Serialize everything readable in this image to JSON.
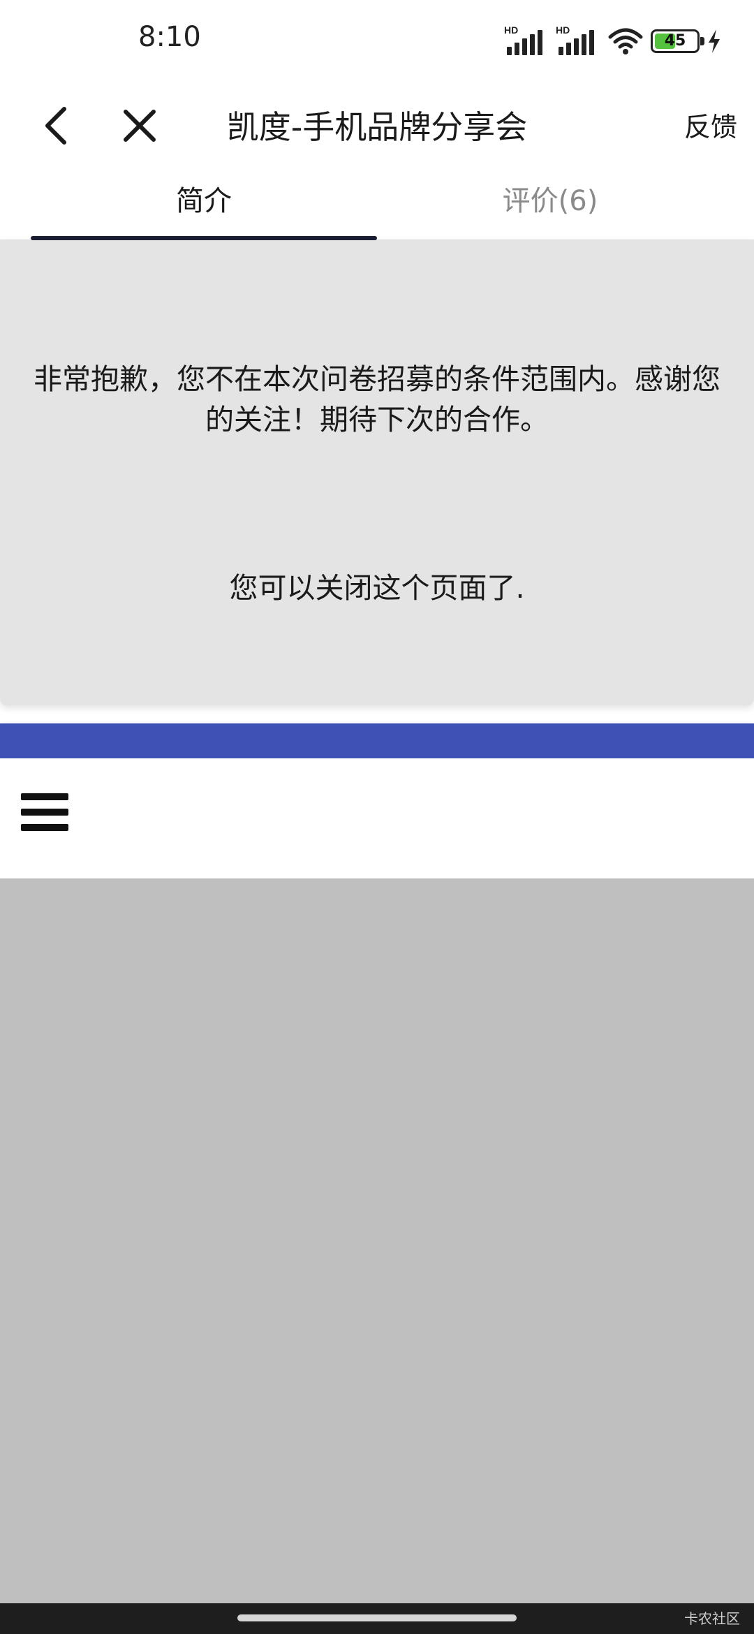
{
  "status_bar": {
    "time": "8:10",
    "network_label_1": "HD",
    "network_label_2": "HD",
    "battery_level": "45",
    "icons": [
      "signal-icon",
      "signal-icon",
      "wifi-icon",
      "battery-icon",
      "charging-icon"
    ]
  },
  "nav": {
    "title": "凯度-手机品牌分享会",
    "feedback_label": "反馈",
    "back_icon": "chevron-left-icon",
    "close_icon": "close-icon"
  },
  "tabs": [
    {
      "label": "简介",
      "active": true
    },
    {
      "label": "评价(6)",
      "active": false
    }
  ],
  "message": {
    "main_text": "非常抱歉，您不在本次问卷招募的条件范围内。感谢您的关注！期待下次的合作。",
    "close_text": "您可以关闭这个页面了."
  },
  "survey_header": {
    "accent_color": "#3f51b5",
    "menu_icon": "hamburger-menu-icon"
  },
  "footer": {
    "watermark": "卡农社区"
  }
}
